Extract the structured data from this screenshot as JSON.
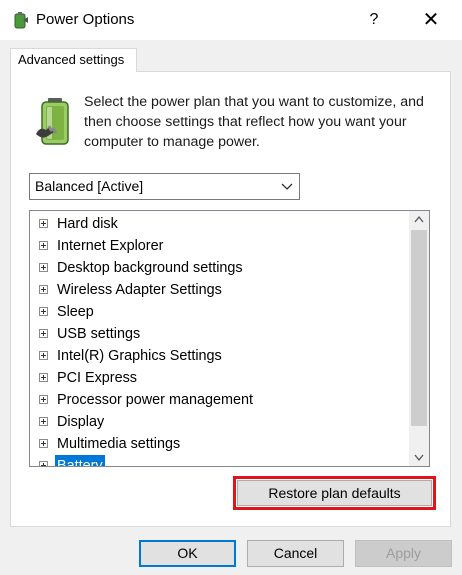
{
  "window": {
    "title": "Power Options",
    "help_glyph": "?",
    "close_glyph": "✕",
    "app_icon": "power-options-icon"
  },
  "tabs": [
    {
      "label": "Advanced settings",
      "selected": true
    }
  ],
  "intro": {
    "icon": "battery-plug-icon",
    "text": "Select the power plan that you want to customize, and then choose settings that reflect how you want your computer to manage power."
  },
  "plan_select": {
    "value": "Balanced [Active]"
  },
  "settings_tree": {
    "items": [
      {
        "label": "Hard disk"
      },
      {
        "label": "Internet Explorer"
      },
      {
        "label": "Desktop background settings"
      },
      {
        "label": "Wireless Adapter Settings"
      },
      {
        "label": "Sleep"
      },
      {
        "label": "USB settings"
      },
      {
        "label": "Intel(R) Graphics Settings"
      },
      {
        "label": "PCI Express"
      },
      {
        "label": "Processor power management"
      },
      {
        "label": "Display"
      },
      {
        "label": "Multimedia settings"
      },
      {
        "label": "Battery"
      }
    ]
  },
  "buttons": {
    "restore": "Restore plan defaults",
    "ok": "OK",
    "cancel": "Cancel",
    "apply": "Apply"
  },
  "colors": {
    "highlight_outline": "#e3121b",
    "selection": "#0078d7",
    "dialog_bg": "#f0f0f0"
  }
}
